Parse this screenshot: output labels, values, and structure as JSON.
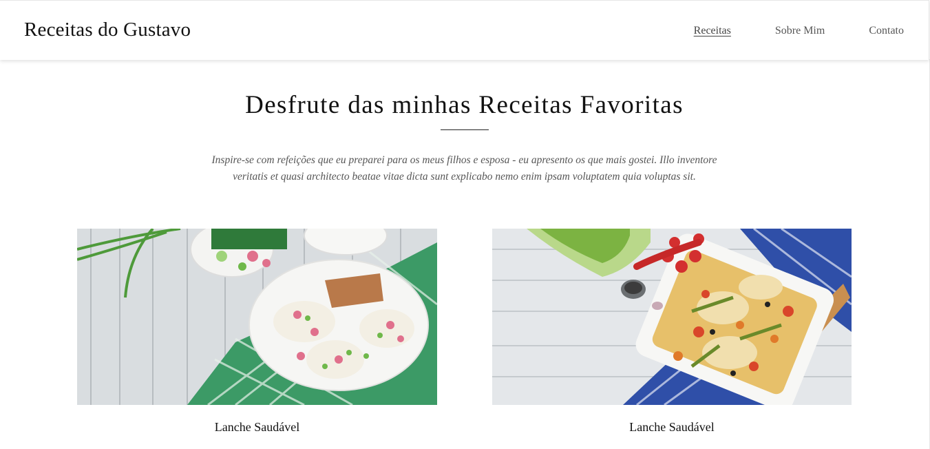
{
  "header": {
    "brand": "Receitas do Gustavo",
    "nav": [
      {
        "label": "Receitas",
        "active": true
      },
      {
        "label": "Sobre Mim",
        "active": false
      },
      {
        "label": "Contato",
        "active": false
      }
    ]
  },
  "hero": {
    "title": "Desfrute das minhas Receitas Favoritas",
    "intro": "Inspire-se com refeições que eu preparei para os meus filhos e esposa - eu apresento os que mais gostei. Illo inventore veritatis et quasi architecto beatae vitae dicta sunt explicabo nemo enim ipsam voluptatem quia voluptas sit."
  },
  "recipes": [
    {
      "title": "Lanche Saudável",
      "image": "healthy-snack-photo"
    },
    {
      "title": "Lanche Saudável",
      "image": "roasted-chicken-vegetables-photo"
    }
  ]
}
